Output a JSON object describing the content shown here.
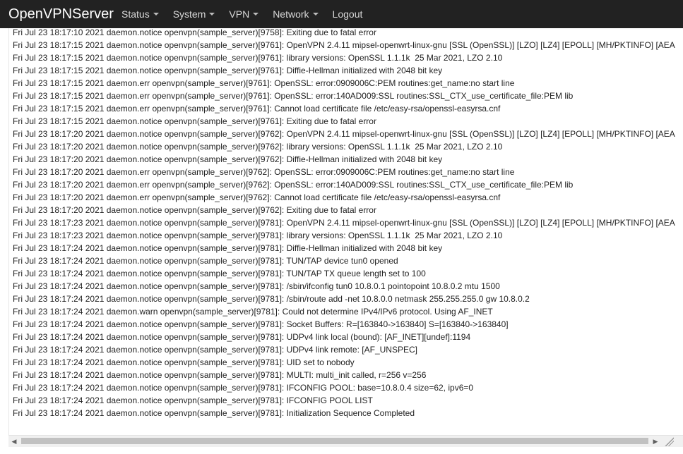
{
  "navbar": {
    "brand": "OpenVPNServer",
    "menu": [
      {
        "label": "Status",
        "has_dropdown": true
      },
      {
        "label": "System",
        "has_dropdown": true
      },
      {
        "label": "VPN",
        "has_dropdown": true
      },
      {
        "label": "Network",
        "has_dropdown": true
      },
      {
        "label": "Logout",
        "has_dropdown": false
      }
    ]
  },
  "log": {
    "lines": [
      "Fri Jul 23 18:17:10 2021 daemon.notice openvpn(sample_server)[9758]: Exiting due to fatal error",
      "Fri Jul 23 18:17:15 2021 daemon.notice openvpn(sample_server)[9761]: OpenVPN 2.4.11 mipsel-openwrt-linux-gnu [SSL (OpenSSL)] [LZO] [LZ4] [EPOLL] [MH/PKTINFO] [AEA",
      "Fri Jul 23 18:17:15 2021 daemon.notice openvpn(sample_server)[9761]: library versions: OpenSSL 1.1.1k  25 Mar 2021, LZO 2.10",
      "Fri Jul 23 18:17:15 2021 daemon.notice openvpn(sample_server)[9761]: Diffie-Hellman initialized with 2048 bit key",
      "Fri Jul 23 18:17:15 2021 daemon.err openvpn(sample_server)[9761]: OpenSSL: error:0909006C:PEM routines:get_name:no start line",
      "Fri Jul 23 18:17:15 2021 daemon.err openvpn(sample_server)[9761]: OpenSSL: error:140AD009:SSL routines:SSL_CTX_use_certificate_file:PEM lib",
      "Fri Jul 23 18:17:15 2021 daemon.err openvpn(sample_server)[9761]: Cannot load certificate file /etc/easy-rsa/openssl-easyrsa.cnf",
      "Fri Jul 23 18:17:15 2021 daemon.notice openvpn(sample_server)[9761]: Exiting due to fatal error",
      "Fri Jul 23 18:17:20 2021 daemon.notice openvpn(sample_server)[9762]: OpenVPN 2.4.11 mipsel-openwrt-linux-gnu [SSL (OpenSSL)] [LZO] [LZ4] [EPOLL] [MH/PKTINFO] [AEA",
      "Fri Jul 23 18:17:20 2021 daemon.notice openvpn(sample_server)[9762]: library versions: OpenSSL 1.1.1k  25 Mar 2021, LZO 2.10",
      "Fri Jul 23 18:17:20 2021 daemon.notice openvpn(sample_server)[9762]: Diffie-Hellman initialized with 2048 bit key",
      "Fri Jul 23 18:17:20 2021 daemon.err openvpn(sample_server)[9762]: OpenSSL: error:0909006C:PEM routines:get_name:no start line",
      "Fri Jul 23 18:17:20 2021 daemon.err openvpn(sample_server)[9762]: OpenSSL: error:140AD009:SSL routines:SSL_CTX_use_certificate_file:PEM lib",
      "Fri Jul 23 18:17:20 2021 daemon.err openvpn(sample_server)[9762]: Cannot load certificate file /etc/easy-rsa/openssl-easyrsa.cnf",
      "Fri Jul 23 18:17:20 2021 daemon.notice openvpn(sample_server)[9762]: Exiting due to fatal error",
      "Fri Jul 23 18:17:23 2021 daemon.notice openvpn(sample_server)[9781]: OpenVPN 2.4.11 mipsel-openwrt-linux-gnu [SSL (OpenSSL)] [LZO] [LZ4] [EPOLL] [MH/PKTINFO] [AEA",
      "Fri Jul 23 18:17:23 2021 daemon.notice openvpn(sample_server)[9781]: library versions: OpenSSL 1.1.1k  25 Mar 2021, LZO 2.10",
      "Fri Jul 23 18:17:24 2021 daemon.notice openvpn(sample_server)[9781]: Diffie-Hellman initialized with 2048 bit key",
      "Fri Jul 23 18:17:24 2021 daemon.notice openvpn(sample_server)[9781]: TUN/TAP device tun0 opened",
      "Fri Jul 23 18:17:24 2021 daemon.notice openvpn(sample_server)[9781]: TUN/TAP TX queue length set to 100",
      "Fri Jul 23 18:17:24 2021 daemon.notice openvpn(sample_server)[9781]: /sbin/ifconfig tun0 10.8.0.1 pointopoint 10.8.0.2 mtu 1500",
      "Fri Jul 23 18:17:24 2021 daemon.notice openvpn(sample_server)[9781]: /sbin/route add -net 10.8.0.0 netmask 255.255.255.0 gw 10.8.0.2",
      "Fri Jul 23 18:17:24 2021 daemon.warn openvpn(sample_server)[9781]: Could not determine IPv4/IPv6 protocol. Using AF_INET",
      "Fri Jul 23 18:17:24 2021 daemon.notice openvpn(sample_server)[9781]: Socket Buffers: R=[163840->163840] S=[163840->163840]",
      "Fri Jul 23 18:17:24 2021 daemon.notice openvpn(sample_server)[9781]: UDPv4 link local (bound): [AF_INET][undef]:1194",
      "Fri Jul 23 18:17:24 2021 daemon.notice openvpn(sample_server)[9781]: UDPv4 link remote: [AF_UNSPEC]",
      "Fri Jul 23 18:17:24 2021 daemon.notice openvpn(sample_server)[9781]: UID set to nobody",
      "Fri Jul 23 18:17:24 2021 daemon.notice openvpn(sample_server)[9781]: MULTI: multi_init called, r=256 v=256",
      "Fri Jul 23 18:17:24 2021 daemon.notice openvpn(sample_server)[9781]: IFCONFIG POOL: base=10.8.0.4 size=62, ipv6=0",
      "Fri Jul 23 18:17:24 2021 daemon.notice openvpn(sample_server)[9781]: IFCONFIG POOL LIST",
      "Fri Jul 23 18:17:24 2021 daemon.notice openvpn(sample_server)[9781]: Initialization Sequence Completed"
    ]
  },
  "scrollbar": {
    "left_arrow": "◀",
    "right_arrow": "▶"
  },
  "colors": {
    "navbar_bg": "#222222",
    "brand_text": "#ffffff",
    "nav_text": "#d8d8d8",
    "log_text": "#222222"
  }
}
